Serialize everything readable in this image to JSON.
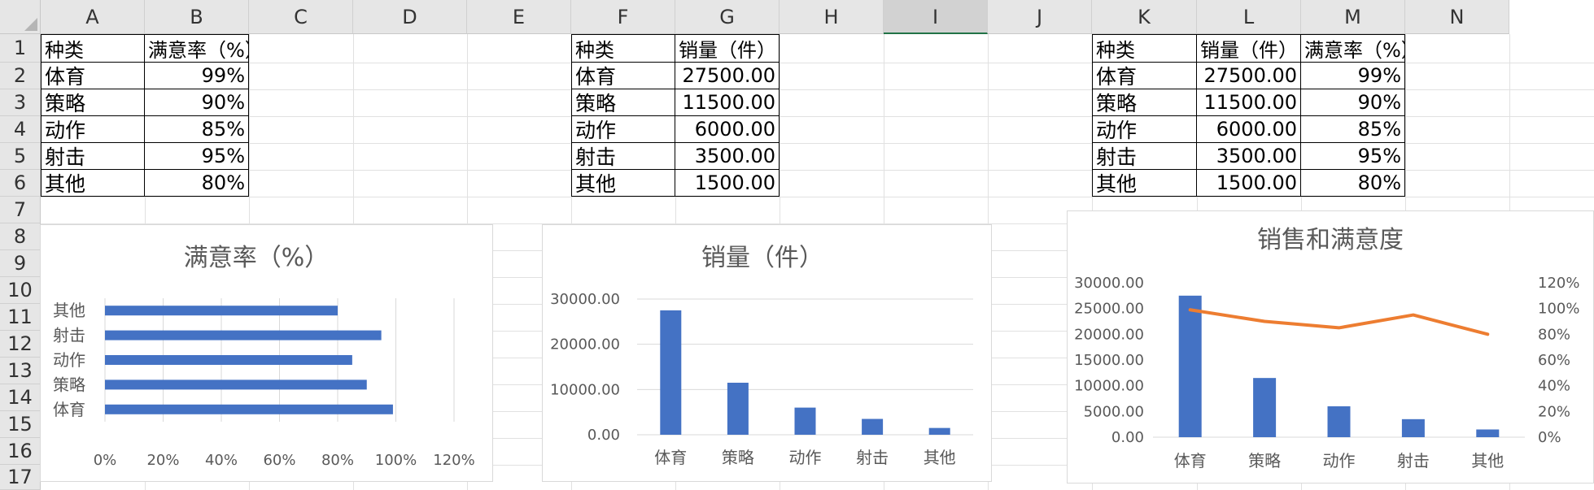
{
  "sheet": {
    "columns": [
      "A",
      "B",
      "C",
      "D",
      "E",
      "F",
      "G",
      "H",
      "I",
      "J",
      "K",
      "L",
      "M",
      "N"
    ],
    "selected_column": "I",
    "rows": [
      "1",
      "2",
      "3",
      "4",
      "5",
      "6",
      "7",
      "8",
      "9",
      "10",
      "11",
      "12",
      "13",
      "14",
      "15",
      "16",
      "17"
    ],
    "table1": {
      "headers": [
        "种类",
        "满意率（%）"
      ],
      "rows": [
        [
          "体育",
          "99%"
        ],
        [
          "策略",
          "90%"
        ],
        [
          "动作",
          "85%"
        ],
        [
          "射击",
          "95%"
        ],
        [
          "其他",
          "80%"
        ]
      ]
    },
    "table2": {
      "headers": [
        "种类",
        "销量（件）"
      ],
      "rows": [
        [
          "体育",
          "27500.00"
        ],
        [
          "策略",
          "11500.00"
        ],
        [
          "动作",
          "6000.00"
        ],
        [
          "射击",
          "3500.00"
        ],
        [
          "其他",
          "1500.00"
        ]
      ]
    },
    "table3": {
      "headers": [
        "种类",
        "销量（件）",
        "满意率（%）"
      ],
      "rows": [
        [
          "体育",
          "27500.00",
          "99%"
        ],
        [
          "策略",
          "11500.00",
          "90%"
        ],
        [
          "动作",
          "6000.00",
          "85%"
        ],
        [
          "射击",
          "3500.00",
          "95%"
        ],
        [
          "其他",
          "1500.00",
          "80%"
        ]
      ]
    }
  },
  "colors": {
    "bar": "#4472c4",
    "line": "#ed7d31",
    "grid": "#d9d9d9",
    "header_bg": "#e6e6e6",
    "selection": "#217346"
  },
  "chart_data": [
    {
      "type": "bar",
      "orientation": "horizontal",
      "title": "满意率（%）",
      "categories": [
        "其他",
        "射击",
        "动作",
        "策略",
        "体育"
      ],
      "values": [
        80,
        95,
        85,
        90,
        99
      ],
      "xlim": [
        0,
        120
      ],
      "xticks": [
        "0%",
        "20%",
        "40%",
        "60%",
        "80%",
        "100%",
        "120%"
      ],
      "grid": "vertical"
    },
    {
      "type": "bar",
      "title": "销量（件）",
      "categories": [
        "体育",
        "策略",
        "动作",
        "射击",
        "其他"
      ],
      "values": [
        27500,
        11500,
        6000,
        3500,
        1500
      ],
      "ylim": [
        0,
        30000
      ],
      "yticks": [
        "0.00",
        "10000.00",
        "20000.00",
        "30000.00"
      ],
      "grid": "horizontal"
    },
    {
      "type": "bar",
      "title": "销售和满意度",
      "categories": [
        "体育",
        "策略",
        "动作",
        "射击",
        "其他"
      ],
      "series": [
        {
          "type": "bar",
          "axis": "left",
          "values": [
            27500,
            11500,
            6000,
            3500,
            1500
          ]
        },
        {
          "type": "line",
          "axis": "right",
          "values": [
            99,
            90,
            85,
            95,
            80
          ]
        }
      ],
      "ylim": [
        0,
        30000
      ],
      "yticks": [
        "0.00",
        "5000.00",
        "10000.00",
        "15000.00",
        "20000.00",
        "25000.00",
        "30000.00"
      ],
      "y2lim": [
        0,
        120
      ],
      "y2ticks": [
        "0%",
        "20%",
        "40%",
        "60%",
        "80%",
        "100%",
        "120%"
      ],
      "grid": "none"
    }
  ]
}
